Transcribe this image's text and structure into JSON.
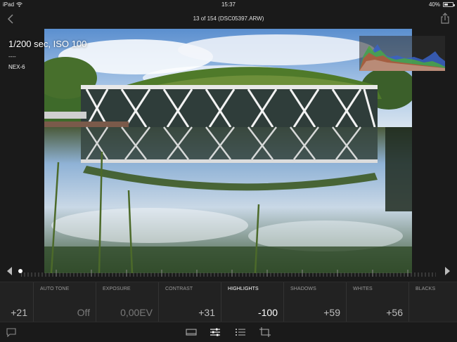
{
  "status_bar": {
    "device": "iPad",
    "time": "15:37",
    "battery": "40%"
  },
  "nav": {
    "title": "13 of 154 (DSC05397.ARW)"
  },
  "photo_info": {
    "exposure": "1/200 sec, ISO 100",
    "lens": "----",
    "camera": "NEX-6"
  },
  "adjustments": [
    {
      "name": "",
      "value": "+21"
    },
    {
      "name": "AUTO TONE",
      "value": "Off"
    },
    {
      "name": "EXPOSURE",
      "value": "0,00EV"
    },
    {
      "name": "CONTRAST",
      "value": "+31"
    },
    {
      "name": "HIGHLIGHTS",
      "value": "-100"
    },
    {
      "name": "SHADOWS",
      "value": "+59"
    },
    {
      "name": "WHITES",
      "value": "+56"
    },
    {
      "name": "BLACKS",
      "value": ""
    }
  ],
  "slider": {
    "position_fraction": 0.0
  },
  "colors": {
    "background": "#1a1a1a",
    "panel": "#222222",
    "active_text": "#ffffff"
  },
  "icons": [
    "back-chevron-icon",
    "share-icon",
    "comment-icon",
    "filmstrip-icon",
    "sliders-icon",
    "list-icon",
    "crop-icon",
    "wifi-icon",
    "battery-icon"
  ]
}
